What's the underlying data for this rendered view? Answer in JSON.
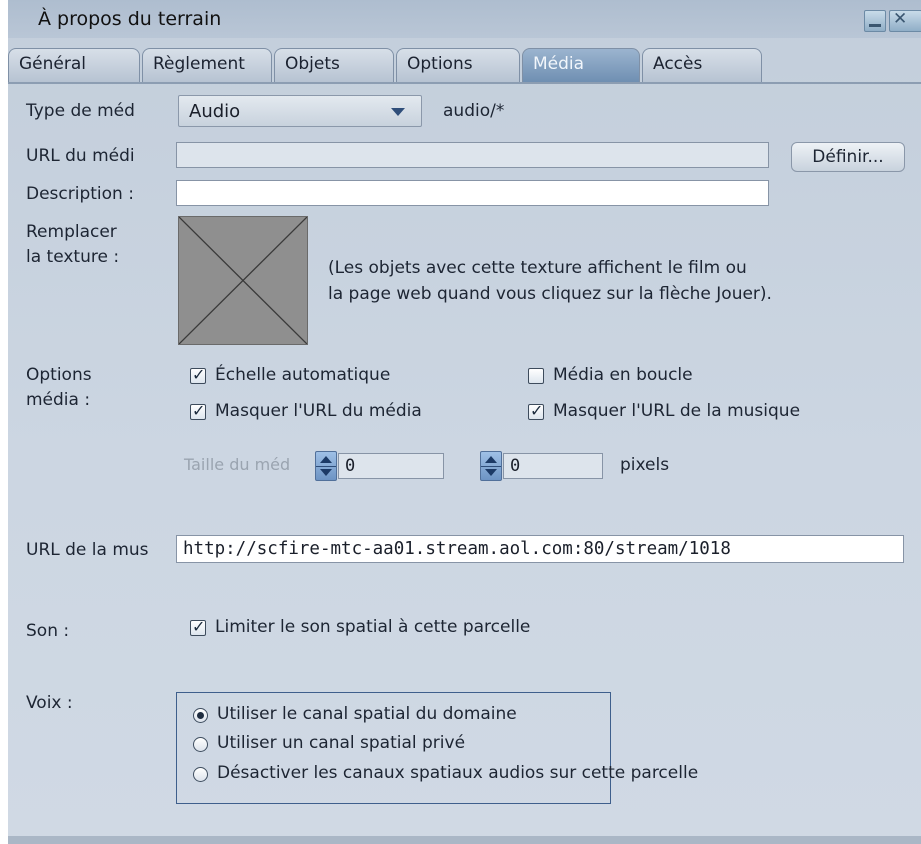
{
  "window": {
    "title": "À propos du terrain"
  },
  "tabs": [
    {
      "label": "Général",
      "active": false
    },
    {
      "label": "Règlement",
      "active": false
    },
    {
      "label": "Objets",
      "active": false
    },
    {
      "label": "Options",
      "active": false
    },
    {
      "label": "Média",
      "active": true
    },
    {
      "label": "Accès",
      "active": false
    }
  ],
  "media": {
    "type_label": "Type de méd",
    "type_value": "Audio",
    "mime": "audio/*",
    "url_label": "URL du médi",
    "url_value": "",
    "set_button": "Définir...",
    "description_label": "Description :",
    "description_value": "",
    "replace_texture_label": [
      "Remplacer",
      "la texture :"
    ],
    "texture_note": [
      "(Les objets avec cette texture affichent le film ou",
      "la page web quand vous cliquez sur la flèche Jouer)."
    ]
  },
  "options": {
    "label": [
      "Options",
      "média :"
    ],
    "checkboxes": [
      {
        "label": "Échelle automatique",
        "checked": true
      },
      {
        "label": "Média en boucle",
        "checked": false
      },
      {
        "label": "Masquer l'URL du média",
        "checked": true
      },
      {
        "label": "Masquer l'URL de la musique",
        "checked": true
      }
    ],
    "size_label": "Taille du méd",
    "width_value": "0",
    "height_value": "0",
    "pixels_label": "pixels"
  },
  "music": {
    "label": "URL de la mus",
    "value": "http://scfire-mtc-aa01.stream.aol.com:80/stream/1018"
  },
  "sound": {
    "label": "Son :",
    "checkbox_label": "Limiter le son spatial à cette parcelle",
    "checked": true
  },
  "voice": {
    "label": "Voix :",
    "options": [
      {
        "label": "Utiliser le canal spatial du domaine",
        "selected": true
      },
      {
        "label": "Utiliser un canal spatial privé",
        "selected": false
      },
      {
        "label": "Désactiver les canaux spatiaux audios sur cette parcelle",
        "selected": false
      }
    ]
  },
  "colors": {
    "panel": "#c3cedb",
    "active_tab": "#7f9dbe",
    "texture_gray": "#8f8f8f",
    "group_border": "#3e5f8c"
  },
  "icons": [
    "minimize-icon",
    "close-icon",
    "dropdown-arrow-icon",
    "spinner-icon"
  ]
}
